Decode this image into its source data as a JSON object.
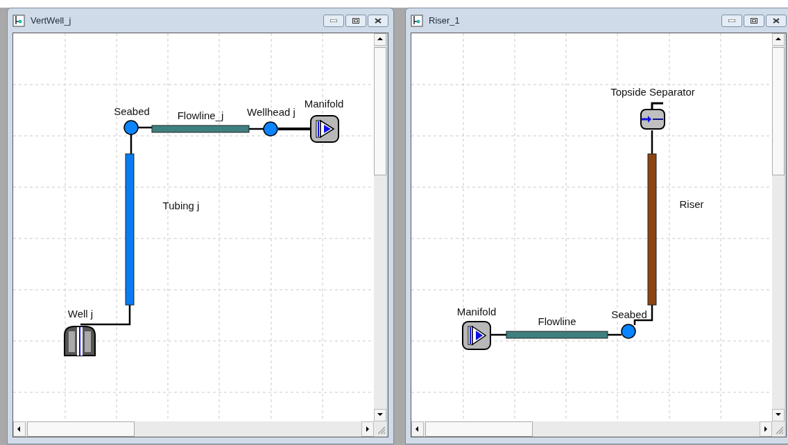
{
  "windows": [
    {
      "title": "VertWell_j",
      "items": [
        {
          "kind": "node",
          "label": "Seabed"
        },
        {
          "kind": "pipe",
          "label": "Flowline_j",
          "color": "#3f7f7f"
        },
        {
          "kind": "node",
          "label": "Wellhead j"
        },
        {
          "kind": "manifold",
          "label": "Manifold"
        },
        {
          "kind": "pipe",
          "label": "Tubing j",
          "color": "#0a7cf0"
        },
        {
          "kind": "well",
          "label": "Well j"
        }
      ]
    },
    {
      "title": "Riser_1",
      "items": [
        {
          "kind": "separator",
          "label": "Topside Separator"
        },
        {
          "kind": "pipe",
          "label": "Riser",
          "color": "#8b4513"
        },
        {
          "kind": "manifold",
          "label": "Manifold"
        },
        {
          "kind": "pipe",
          "label": "Flowline",
          "color": "#3f7f7f"
        },
        {
          "kind": "node",
          "label": "Seabed"
        }
      ]
    }
  ]
}
